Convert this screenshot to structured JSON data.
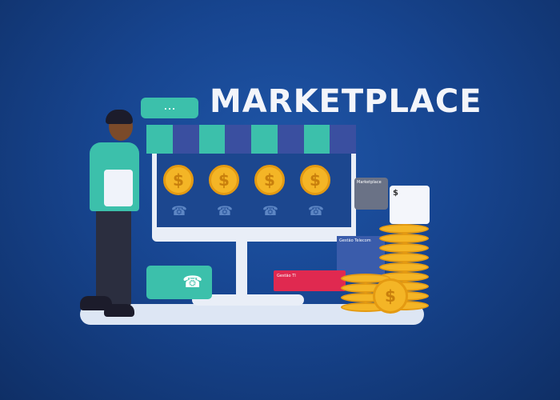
{
  "title": "MARKETPLACE",
  "bubble": "...",
  "coin_symbol": "$",
  "phone_symbol": "☎",
  "cards": {
    "marketplace": "Marketplace",
    "invoice_symbol": "$",
    "telecom": "Gestão Telecom",
    "it": "Gestão TI"
  },
  "colors": {
    "background": "#174590",
    "teal": "#3cc0ab",
    "gold": "#f4b526",
    "red": "#e02950",
    "awning_dark": "#3a4fa0"
  }
}
